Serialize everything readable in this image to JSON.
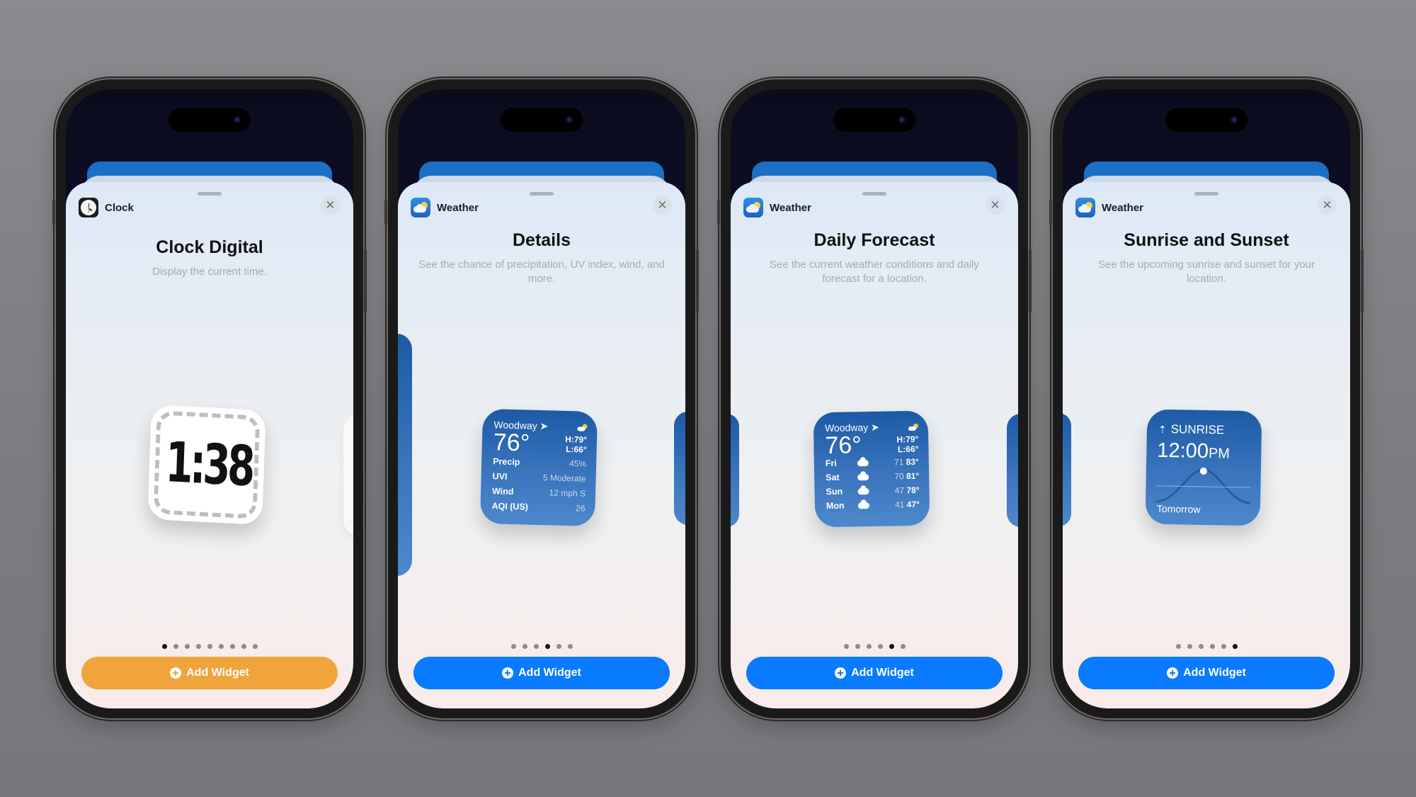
{
  "colors": {
    "add_orange": "#EFA53C",
    "add_blue": "#0A7AFF",
    "widget_blue": "#2C68B4"
  },
  "phones": [
    {
      "app": {
        "name": "Clock",
        "icon": "clock-app-icon"
      },
      "close_icon": "✕",
      "title": "Clock Digital",
      "description": "Display the current time.",
      "widget": {
        "type": "clock-digital",
        "time": "1:38"
      },
      "page_dots": {
        "count": 9,
        "active_index": 0
      },
      "add_button": {
        "label": "Add Widget",
        "icon": "plus-circle-icon",
        "color": "#EFA53C"
      }
    },
    {
      "app": {
        "name": "Weather",
        "icon": "weather-app-icon"
      },
      "close_icon": "✕",
      "title": "Details",
      "description": "See the chance of precipitation, UV index, wind, and more.",
      "widget": {
        "type": "weather-details",
        "location": "Woodway",
        "location_icon": "location-arrow-icon",
        "temp": "76°",
        "high": "H:79°",
        "low": "L:66°",
        "rows": [
          {
            "label": "Precip",
            "value": "45%"
          },
          {
            "label": "UVI",
            "value": "5 Moderate"
          },
          {
            "label": "Wind",
            "value": "12 mph S"
          },
          {
            "label": "AQI (US)",
            "value": "26"
          }
        ]
      },
      "page_dots": {
        "count": 6,
        "active_index": 3
      },
      "add_button": {
        "label": "Add Widget",
        "icon": "plus-circle-icon",
        "color": "#0A7AFF"
      }
    },
    {
      "app": {
        "name": "Weather",
        "icon": "weather-app-icon"
      },
      "close_icon": "✕",
      "title": "Daily Forecast",
      "description": "See the current weather conditions and daily forecast for a location.",
      "widget": {
        "type": "weather-daily",
        "location": "Woodway",
        "location_icon": "location-arrow-icon",
        "temp": "76°",
        "high": "H:79°",
        "low": "L:66°",
        "days": [
          {
            "day": "Fri",
            "icon": "rain-cloud-icon",
            "low": "71",
            "high": "83°"
          },
          {
            "day": "Sat",
            "icon": "cloud-icon",
            "low": "70",
            "high": "81°"
          },
          {
            "day": "Sun",
            "icon": "rain-cloud-icon",
            "low": "47",
            "high": "78°"
          },
          {
            "day": "Mon",
            "icon": "rain-cloud-icon",
            "low": "41",
            "high": "47°"
          }
        ]
      },
      "page_dots": {
        "count": 6,
        "active_index": 4
      },
      "add_button": {
        "label": "Add Widget",
        "icon": "plus-circle-icon",
        "color": "#0A7AFF"
      }
    },
    {
      "app": {
        "name": "Weather",
        "icon": "weather-app-icon"
      },
      "close_icon": "✕",
      "title": "Sunrise and Sunset",
      "description": "See the upcoming sunrise and sunset for your location.",
      "widget": {
        "type": "sunrise",
        "label": "SUNRISE",
        "time": "12:00",
        "ampm": "PM",
        "footer": "Tomorrow"
      },
      "page_dots": {
        "count": 6,
        "active_index": 5
      },
      "add_button": {
        "label": "Add Widget",
        "icon": "plus-circle-icon",
        "color": "#0A7AFF"
      }
    }
  ]
}
